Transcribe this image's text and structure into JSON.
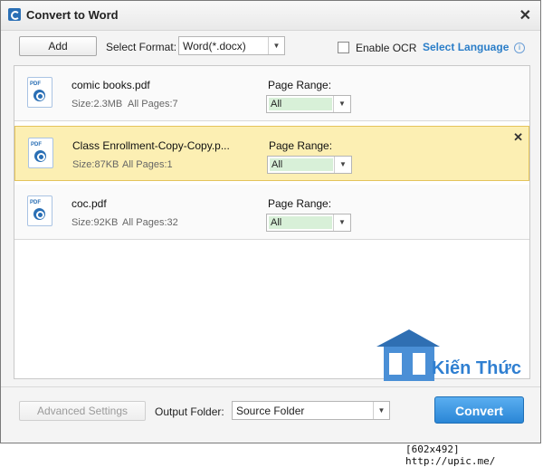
{
  "window": {
    "title": "Convert to Word"
  },
  "toolbar": {
    "add_label": "Add",
    "format_label": "Select Format:",
    "format_value": "Word(*.docx)",
    "ocr_label": "Enable OCR",
    "ocr_checked": false,
    "language_link": "Select Language"
  },
  "files": [
    {
      "name": "comic books.pdf",
      "size": "Size:2.3MB",
      "pages": "All Pages:7",
      "range_label": "Page Range:",
      "range_value": "All",
      "selected": false
    },
    {
      "name": "Class Enrollment-Copy-Copy.p...",
      "size": "Size:87KB",
      "pages": "All Pages:1",
      "range_label": "Page Range:",
      "range_value": "All",
      "selected": true
    },
    {
      "name": "coc.pdf",
      "size": "Size:92KB",
      "pages": "All Pages:32",
      "range_label": "Page Range:",
      "range_value": "All",
      "selected": false
    }
  ],
  "bottom": {
    "advanced_label": "Advanced Settings",
    "output_label": "Output Folder:",
    "output_value": "Source Folder",
    "convert_label": "Convert"
  },
  "watermark": {
    "text": "Kiến Thức"
  },
  "caption": "[602x492] http://upic.me/",
  "colors": {
    "accent": "#2b7ec8",
    "selected_row": "#fcefb3",
    "range_fill": "#d8f0d8"
  },
  "icons": {
    "app": "app-logo-icon",
    "close": "close-icon",
    "file": "pdf-file-icon",
    "dropdown": "chevron-down-icon",
    "info": "info-icon"
  }
}
